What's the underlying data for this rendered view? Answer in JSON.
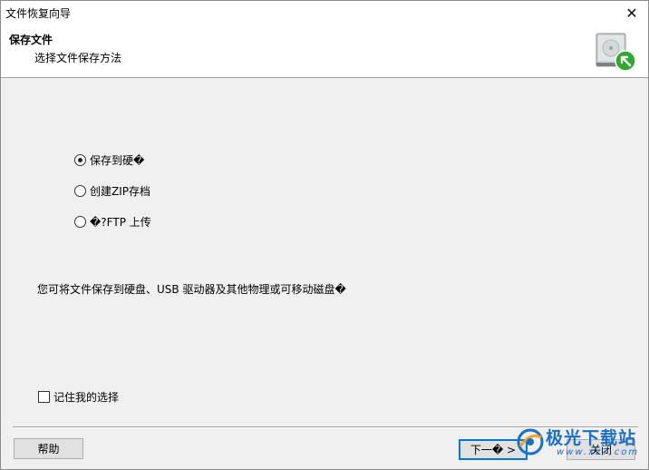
{
  "window": {
    "title": "文件恢复向导",
    "close_glyph": "✕"
  },
  "header": {
    "title": "保存文件",
    "subtitle": "选择文件保存方法",
    "icon": "hard-drive-restore-icon"
  },
  "options": [
    {
      "label": "保存到硬�",
      "checked": true
    },
    {
      "label": "创建ZIP存档",
      "checked": false
    },
    {
      "label": "�?FTP 上传",
      "checked": false
    }
  ],
  "description": "您可将文件保存到硬盘、USB 驱动器及其他物理或可移动磁盘�",
  "remember": {
    "label": "记住我的选择",
    "checked": false
  },
  "buttons": {
    "help": "帮助",
    "next": "下一� >",
    "close": "关闭"
  },
  "watermark": {
    "text": "极光下载站",
    "url": "www.xz7.com"
  },
  "colors": {
    "accent": "#0078d7",
    "icon_green": "#2fa82f",
    "watermark": "#1a6fc9"
  }
}
